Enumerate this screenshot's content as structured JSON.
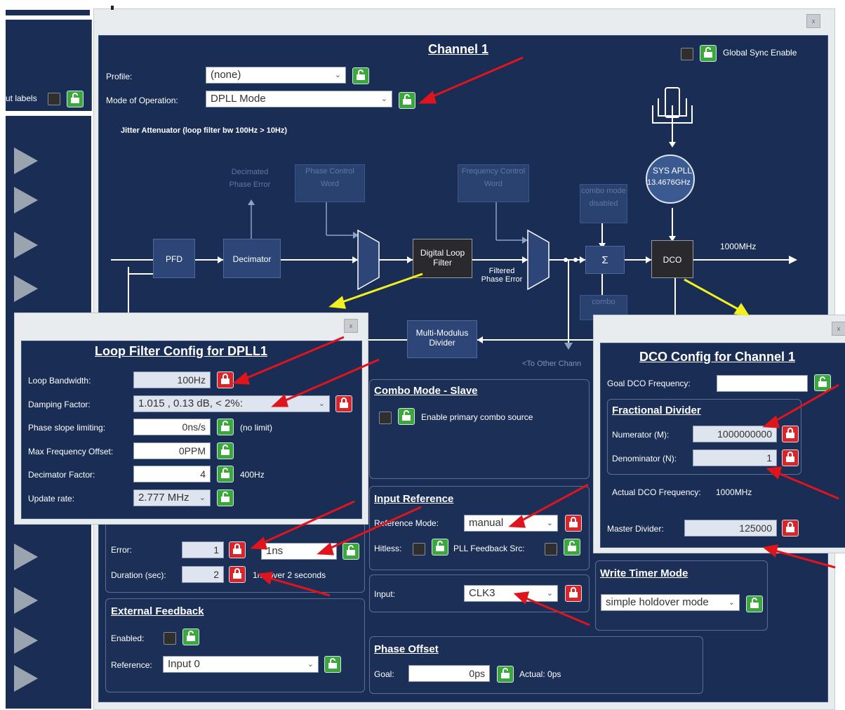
{
  "left_strip": {
    "labels_text": "ut labels"
  },
  "channel": {
    "title": "Channel 1",
    "global_sync_label": "Global Sync Enable",
    "profile_label": "Profile:",
    "profile_value": "(none)",
    "mode_label": "Mode of Operation:",
    "mode_value": "DPLL Mode",
    "subtitle": "Jitter Attenuator (loop filter bw 100Hz > 10Hz)"
  },
  "diagram": {
    "pfd": "PFD",
    "decimator": "Decimator",
    "digital_loop_filter": "Digital Loop Filter",
    "filtered_phase_error": "Filtered Phase Error",
    "sigma": "Σ",
    "dco": "DCO",
    "sys_apll": "SYS APLL",
    "sys_apll_freq": "13.4676GHz",
    "output_freq": "1000MHz",
    "mmd": "Multi-Modulus Divider",
    "to_other": "<To Other Chann",
    "ghost_decimated": "Decimated Phase Error",
    "ghost_phase_cw": "Phase Control Word",
    "ghost_freq_cw": "Frequency Control Word",
    "ghost_combo1": "combo mode disabled",
    "ghost_combo2": "combo"
  },
  "loop_filter": {
    "title": "Loop Filter Config for DPLL1",
    "bandwidth_label": "Loop Bandwidth:",
    "bandwidth_value": "100Hz",
    "damping_label": "Damping Factor:",
    "damping_value": "1.015 , 0.13 dB, < 2%:",
    "phase_slope_label": "Phase slope limiting:",
    "phase_slope_value": "0ns/s",
    "phase_slope_note": "(no limit)",
    "max_freq_label": "Max Frequency Offset:",
    "max_freq_value": "0PPM",
    "decimator_label": "Decimator Factor:",
    "decimator_value": "4",
    "decimator_note": "400Hz",
    "update_label": "Update rate:",
    "update_value": "2.777 MHz"
  },
  "pfd_section": {
    "error_label": "Error:",
    "error_value": "1",
    "error_unit": "1ns",
    "duration_label": "Duration (sec):",
    "duration_value": "2",
    "duration_note": "1ns over 2 seconds"
  },
  "external_feedback": {
    "title": "External Feedback",
    "enabled_label": "Enabled:",
    "reference_label": "Reference:",
    "reference_value": "Input 0"
  },
  "combo": {
    "title": "Combo Mode - Slave",
    "enable_label": "Enable primary combo source"
  },
  "input_reference": {
    "title": "Input Reference",
    "mode_label": "Reference Mode:",
    "mode_value": "manual",
    "hitless_label": "Hitless:",
    "pll_fb_label": "PLL Feedback Src:",
    "input_label": "Input:",
    "input_value": "CLK3"
  },
  "phase_offset": {
    "title": "Phase Offset",
    "goal_label": "Goal:",
    "goal_value": "0ps",
    "actual_label": "Actual: 0ps"
  },
  "write_timer": {
    "title": "Write Timer Mode",
    "value": "simple holdover mode"
  },
  "dco_config": {
    "title": "DCO Config for Channel 1",
    "goal_label": "Goal DCO Frequency:",
    "goal_value": "",
    "frac_title": "Fractional Divider",
    "numerator_label": "Numerator (M):",
    "numerator_value": "1000000000",
    "denominator_label": "Denominator (N):",
    "denominator_value": "1",
    "actual_label": "Actual DCO Frequency:",
    "actual_value": "1000MHz",
    "master_label": "Master Divider:",
    "master_value": "125000"
  },
  "colors": {
    "navy": "#1b2f57",
    "lock_green": "#3aa83a",
    "lock_red": "#d9252a",
    "arrow_red": "#e0141c",
    "arrow_yellow": "#f2f01e"
  }
}
